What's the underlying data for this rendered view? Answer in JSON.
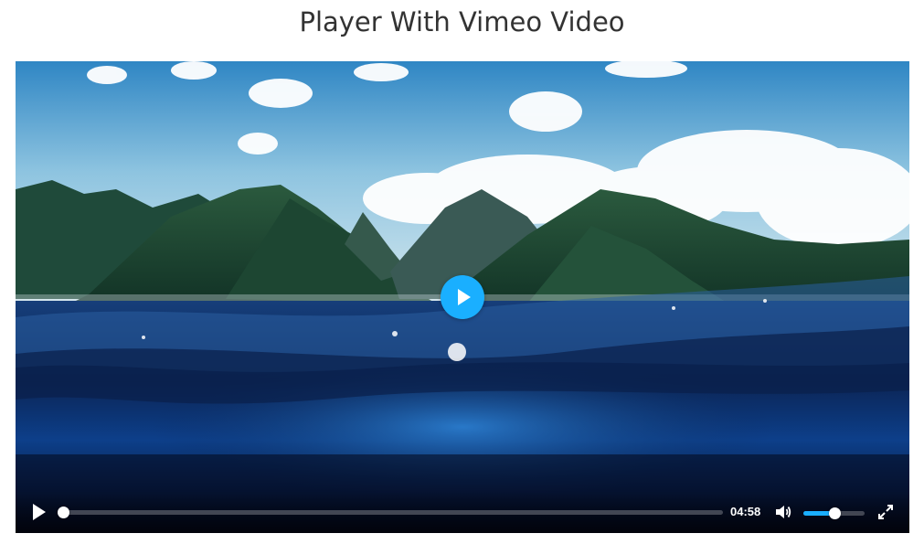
{
  "page": {
    "title": "Player With Vimeo Video"
  },
  "player": {
    "accent_color": "#1aafff",
    "video_frame": "ocean surface with green volcanic mountains and clouds",
    "center_button": {
      "icon": "play-icon"
    },
    "controls": {
      "play_icon": "play-icon",
      "progress_fraction": 0.0,
      "time_display": "04:58",
      "mute_icon": "volume-icon",
      "volume_fraction": 0.5,
      "fullscreen_icon": "fullscreen-icon"
    }
  }
}
